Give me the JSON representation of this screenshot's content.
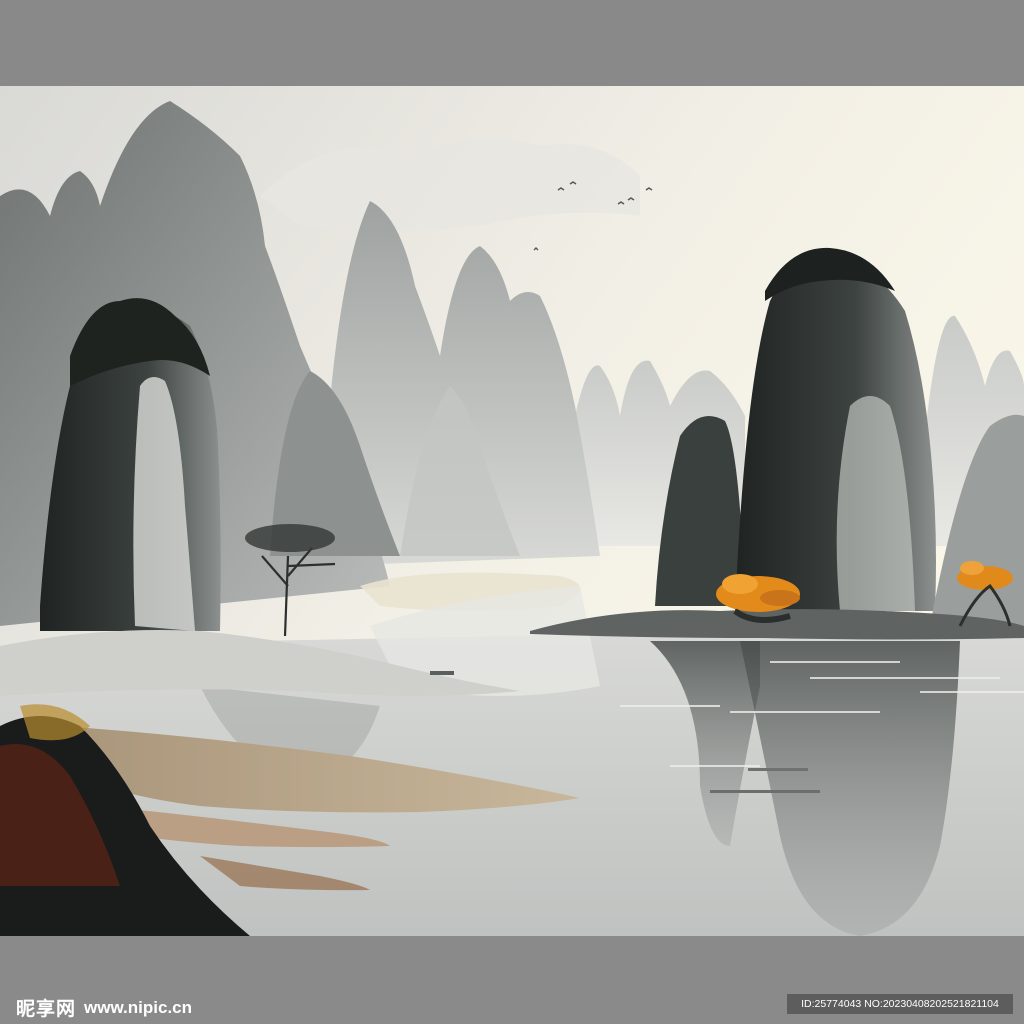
{
  "colors": {
    "frame": "#8a8a8a",
    "sky_light": "#f6f2e6",
    "mist": "#d6d7d3",
    "rock_dark": "#2f3432",
    "water": "#c9cbc9",
    "autumn_orange": "#e28a1a",
    "sand": "#b8a283"
  },
  "watermark": {
    "logo_text": "昵享网",
    "url_text": "www.nipic.cn"
  },
  "image_id": {
    "text": "ID:25774043 NO:20230408202521821104"
  }
}
